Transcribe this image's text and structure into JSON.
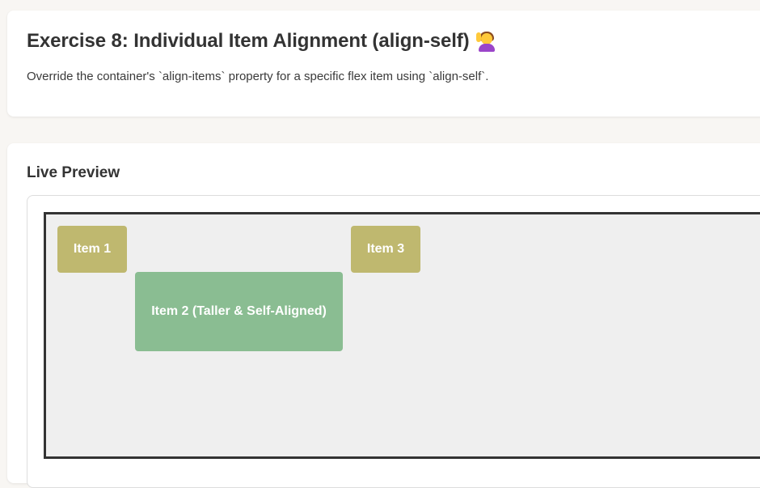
{
  "header": {
    "title": "Exercise 8: Individual Item Alignment (align-self)",
    "emoji_icon": "person-raising-hand-icon",
    "description": "Override the container's `align-items` property for a specific flex item using `align-self`."
  },
  "preview": {
    "section_title": "Live Preview",
    "items": [
      {
        "label": "Item 1",
        "color": "#bfb86f"
      },
      {
        "label": "Item 2 (Taller & Self-Aligned)",
        "color": "#8abd92"
      },
      {
        "label": "Item 3",
        "color": "#bfb86f"
      }
    ],
    "container_background": "#efefef",
    "container_border_color": "#333333"
  },
  "colors": {
    "page_background": "#f8f6f3",
    "card_background": "#ffffff",
    "text": "#333333"
  }
}
